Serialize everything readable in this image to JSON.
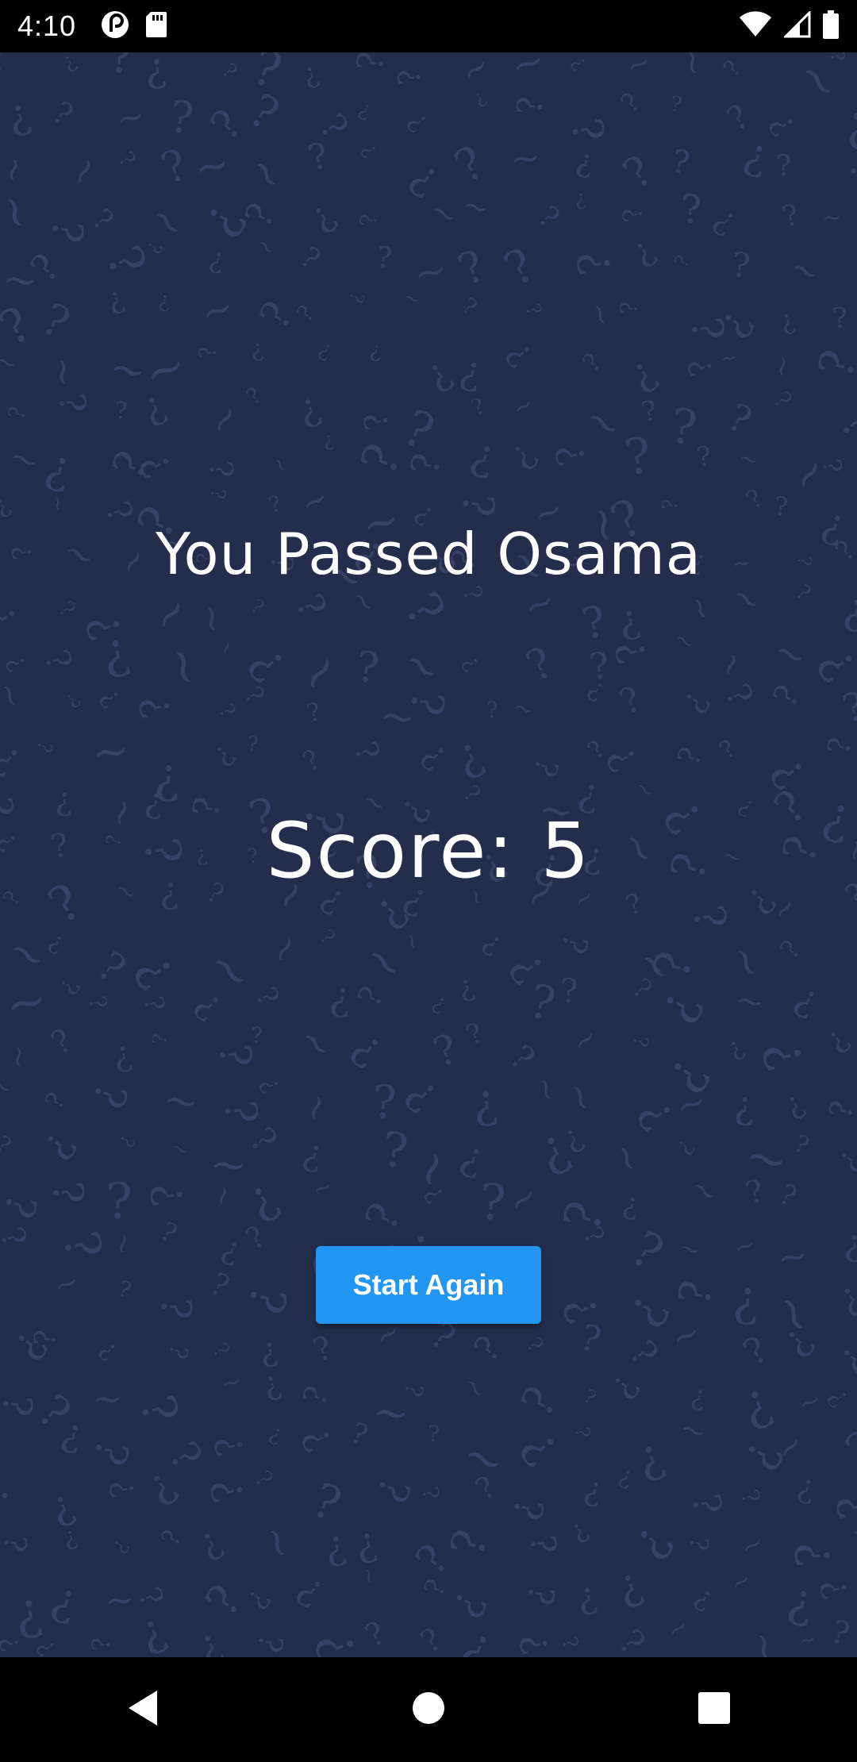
{
  "status_bar": {
    "time": "4:10"
  },
  "result": {
    "title": "You Passed Osama",
    "score_label": "Score: 5"
  },
  "actions": {
    "start_again_label": "Start Again"
  },
  "icons": {
    "status_left": [
      "pocketcasts-icon",
      "sd-card-icon"
    ],
    "status_right": [
      "wifi-icon",
      "signal-icon",
      "battery-icon"
    ],
    "nav": [
      "back-icon",
      "home-icon",
      "recents-icon"
    ]
  },
  "colors": {
    "background": "#252d4d",
    "pattern": "#3a4468",
    "accent": "#2196f3"
  }
}
